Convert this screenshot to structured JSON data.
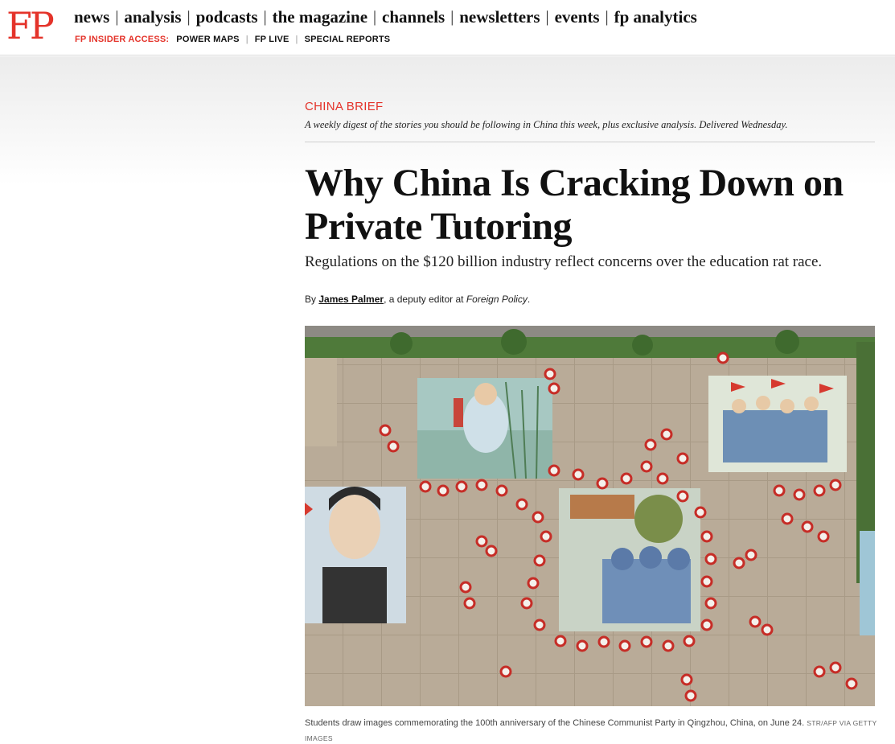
{
  "header": {
    "logo": "FP",
    "nav": [
      "news",
      "analysis",
      "podcasts",
      "the magazine",
      "channels",
      "newsletters",
      "events",
      "fp analytics"
    ],
    "insider_label": "FP INSIDER ACCESS:",
    "subnav": [
      "POWER MAPS",
      "FP LIVE",
      "SPECIAL REPORTS"
    ]
  },
  "article": {
    "kicker": "CHINA BRIEF",
    "digest": "A weekly digest of the stories you should be following in China this week, plus exclusive analysis. Delivered Wednesday.",
    "headline": "Why China Is Cracking Down on Private Tutoring",
    "dek": "Regulations on the $120 billion industry reflect concerns over the education rat race.",
    "byline": {
      "prefix": "By ",
      "author": "James Palmer",
      "role": ", a deputy editor at ",
      "publication": "Foreign Policy",
      "suffix": "."
    }
  },
  "photo": {
    "caption": "Students draw images commemorating the 100th anniversary of the Chinese Communist Party in Qingzhou, China, on June 24.",
    "credit": "STR/AFP VIA GETTY IMAGES"
  },
  "colors": {
    "accent": "#e4332a",
    "text": "#111111"
  }
}
